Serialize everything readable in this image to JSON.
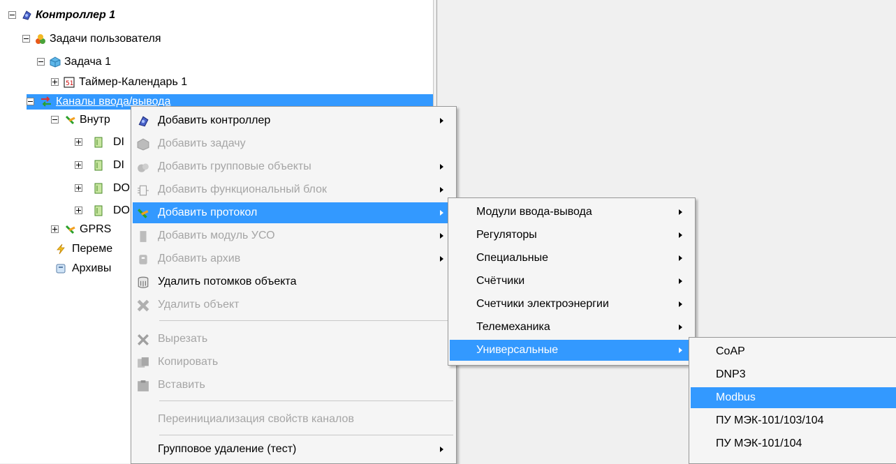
{
  "tree": {
    "items": [
      {
        "label": "Контроллер 1"
      },
      {
        "label": "Задачи пользователя"
      },
      {
        "label": "Задача 1"
      },
      {
        "label": "Таймер-Календарь 1"
      },
      {
        "label": "Каналы ввода/вывода"
      },
      {
        "label": "Внутр"
      },
      {
        "label": "DI"
      },
      {
        "label": "DI"
      },
      {
        "label": "DO"
      },
      {
        "label": "DO"
      },
      {
        "label": "GPRS"
      },
      {
        "label": "Переме"
      },
      {
        "label": "Архивы"
      }
    ]
  },
  "context_menu": {
    "items": [
      {
        "label": "Добавить контроллер"
      },
      {
        "label": "Добавить задачу"
      },
      {
        "label": "Добавить групповые объекты"
      },
      {
        "label": "Добавить функциональный блок"
      },
      {
        "label": "Добавить протокол"
      },
      {
        "label": "Добавить модуль УСО"
      },
      {
        "label": "Добавить архив"
      },
      {
        "label": "Удалить потомков объекта"
      },
      {
        "label": "Удалить объект"
      },
      {
        "label": "Вырезать"
      },
      {
        "label": "Копировать"
      },
      {
        "label": "Вставить"
      },
      {
        "label": "Переинициализация свойств каналов"
      },
      {
        "label": "Групповое удаление (тест)"
      }
    ]
  },
  "protocol_submenu": {
    "items": [
      {
        "label": "Модули ввода-вывода"
      },
      {
        "label": "Регуляторы"
      },
      {
        "label": "Специальные"
      },
      {
        "label": "Счётчики"
      },
      {
        "label": "Счетчики электроэнергии"
      },
      {
        "label": "Телемеханика"
      },
      {
        "label": "Универсальные"
      }
    ]
  },
  "universal_submenu": {
    "items": [
      {
        "label": "CoAP"
      },
      {
        "label": "DNP3"
      },
      {
        "label": "Modbus"
      },
      {
        "label": "ПУ МЭК-101/103/104"
      },
      {
        "label": "ПУ МЭК-101/104"
      }
    ]
  },
  "colors": {
    "selection": "#3399ff",
    "disabled_text": "#a5a5a5",
    "menu_background": "#f5f5f5"
  }
}
